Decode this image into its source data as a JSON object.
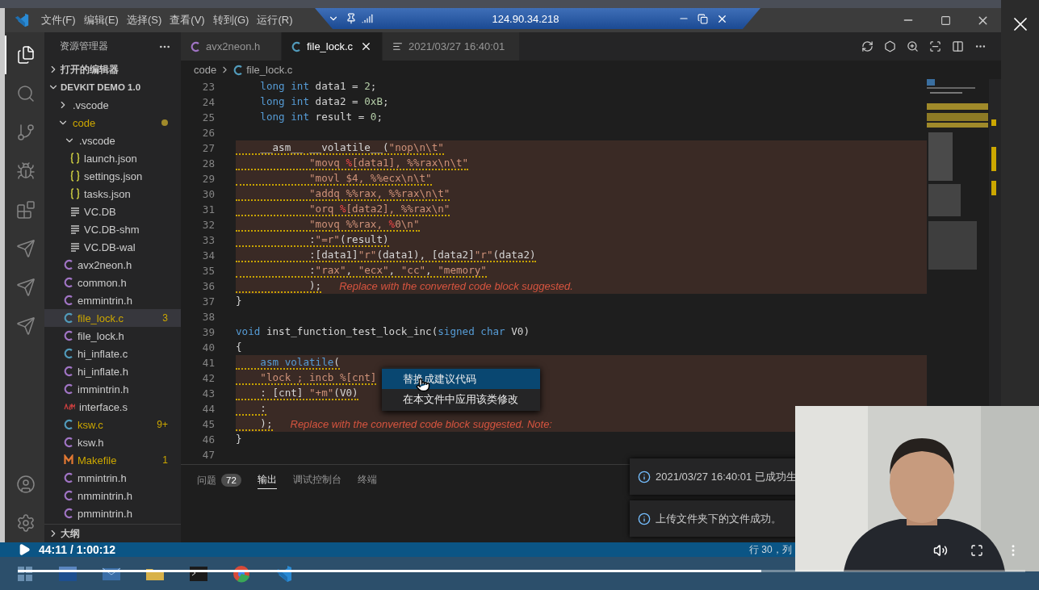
{
  "title_bar": {
    "menus": [
      "文件(F)",
      "编辑(E)",
      "选择(S)",
      "查看(V)",
      "转到(G)",
      "运行(R)"
    ]
  },
  "remote_bar": {
    "host": "124.90.34.218"
  },
  "activity_bar": [
    {
      "kind": "explorer",
      "selected": true
    },
    {
      "kind": "search",
      "selected": false
    },
    {
      "kind": "scm",
      "selected": false
    },
    {
      "kind": "debug",
      "selected": false
    },
    {
      "kind": "extensions",
      "selected": false
    },
    {
      "kind": "plugin",
      "selected": false
    },
    {
      "kind": "plugin",
      "selected": false
    },
    {
      "kind": "plugin",
      "selected": false
    },
    {
      "kind": "account",
      "selected": false
    },
    {
      "kind": "settings",
      "selected": false
    }
  ],
  "sidebar": {
    "title": "资源管理器",
    "open_editors": {
      "label": "打开的编辑器",
      "expanded": false
    },
    "workspace": {
      "label": "DEVKIT DEMO 1.0",
      "expanded": true,
      "items": [
        {
          "name": ".vscode",
          "kind": "folder",
          "expanded": false,
          "warning": false,
          "selected": false
        },
        {
          "name": "code",
          "kind": "folder",
          "expanded": true,
          "warning": true,
          "selected": false,
          "children": [
            {
              "name": ".vscode",
              "kind": "folder",
              "expanded": true,
              "warning": false,
              "selected": false,
              "children": [
                {
                  "name": "launch.json",
                  "kind": "json",
                  "warning": false,
                  "selected": false
                },
                {
                  "name": "settings.json",
                  "kind": "json",
                  "warning": false,
                  "selected": false
                },
                {
                  "name": "tasks.json",
                  "kind": "json",
                  "warning": false,
                  "selected": false
                },
                {
                  "name": "VC.DB",
                  "kind": "text",
                  "warning": false,
                  "selected": false
                },
                {
                  "name": "VC.DB-shm",
                  "kind": "text",
                  "warning": false,
                  "selected": false
                },
                {
                  "name": "VC.DB-wal",
                  "kind": "text",
                  "warning": false,
                  "selected": false
                }
              ]
            },
            {
              "name": "avx2neon.h",
              "kind": "header",
              "warning": false,
              "selected": false
            },
            {
              "name": "common.h",
              "kind": "header",
              "warning": false,
              "selected": false
            },
            {
              "name": "emmintrin.h",
              "kind": "header",
              "warning": false,
              "selected": false
            },
            {
              "name": "file_lock.c",
              "kind": "c",
              "warning": true,
              "selected": true,
              "badge": "3"
            },
            {
              "name": "file_lock.h",
              "kind": "header",
              "warning": false,
              "selected": false
            },
            {
              "name": "hi_inflate.c",
              "kind": "c",
              "warning": false,
              "selected": false
            },
            {
              "name": "hi_inflate.h",
              "kind": "header",
              "warning": false,
              "selected": false
            },
            {
              "name": "immintrin.h",
              "kind": "header",
              "warning": false,
              "selected": false
            },
            {
              "name": "interface.s",
              "kind": "asm",
              "warning": false,
              "selected": false
            },
            {
              "name": "ksw.c",
              "kind": "c",
              "warning": true,
              "selected": false,
              "badge": "9+"
            },
            {
              "name": "ksw.h",
              "kind": "header",
              "warning": false,
              "selected": false
            },
            {
              "name": "Makefile",
              "kind": "make",
              "warning": true,
              "selected": false,
              "badge": "1"
            },
            {
              "name": "mmintrin.h",
              "kind": "header",
              "warning": false,
              "selected": false
            },
            {
              "name": "nmmintrin.h",
              "kind": "header",
              "warning": false,
              "selected": false
            },
            {
              "name": "pmmintrin.h",
              "kind": "header",
              "warning": false,
              "selected": false
            }
          ]
        }
      ]
    },
    "outline": {
      "label": "大纲",
      "expanded": false
    }
  },
  "tabs": [
    {
      "label": "avx2neon.h",
      "kind": "header",
      "selected": false
    },
    {
      "label": "file_lock.c",
      "kind": "c",
      "selected": true
    },
    {
      "label": "2021/03/27 16:40:01",
      "kind": "output",
      "selected": false
    }
  ],
  "breadcrumb": [
    {
      "label": "code",
      "kind": "folder"
    },
    {
      "label": "file_lock.c",
      "kind": "c"
    }
  ],
  "code": {
    "lines": [
      {
        "num": "23",
        "highlight": false,
        "squiggle": false,
        "tokens": [
          {
            "kind": "kw",
            "text": "    long int"
          },
          {
            "kind": "plain",
            "text": " data1 = "
          },
          {
            "kind": "num",
            "text": "2"
          },
          {
            "kind": "plain",
            "text": ";"
          }
        ]
      },
      {
        "num": "24",
        "highlight": false,
        "squiggle": false,
        "tokens": [
          {
            "kind": "kw",
            "text": "    long int"
          },
          {
            "kind": "plain",
            "text": " data2 = "
          },
          {
            "kind": "num",
            "text": "0xB"
          },
          {
            "kind": "plain",
            "text": ";"
          }
        ]
      },
      {
        "num": "25",
        "highlight": false,
        "squiggle": false,
        "tokens": [
          {
            "kind": "kw",
            "text": "    long int"
          },
          {
            "kind": "plain",
            "text": " result = "
          },
          {
            "kind": "num",
            "text": "0"
          },
          {
            "kind": "plain",
            "text": ";"
          }
        ]
      },
      {
        "num": "26",
        "highlight": false
      },
      {
        "num": "27",
        "highlight": true,
        "squiggle": true,
        "tokens": [
          {
            "kind": "plain",
            "text": "    __asm__ __volatile__("
          },
          {
            "kind": "str",
            "text": "\"nop\\n\\t\""
          }
        ]
      },
      {
        "num": "28",
        "highlight": true,
        "squiggle": true,
        "tokens": [
          {
            "kind": "str",
            "text": "            \"movq "
          },
          {
            "kind": "fmt",
            "text": "%"
          },
          {
            "kind": "str",
            "text": "[data1], %%rax\\n\\t\""
          }
        ]
      },
      {
        "num": "29",
        "highlight": true,
        "squiggle": true,
        "tokens": [
          {
            "kind": "str",
            "text": "            \"movl $4, %%ecx\\n\\t\""
          }
        ]
      },
      {
        "num": "30",
        "highlight": true,
        "squiggle": true,
        "tokens": [
          {
            "kind": "str",
            "text": "            \"addq %%rax, %%rax\\n\\t\""
          }
        ]
      },
      {
        "num": "31",
        "highlight": true,
        "squiggle": true,
        "tokens": [
          {
            "kind": "str",
            "text": "            \"orq "
          },
          {
            "kind": "fmt",
            "text": "%"
          },
          {
            "kind": "str",
            "text": "[data2], %%rax\\n\""
          }
        ]
      },
      {
        "num": "32",
        "highlight": true,
        "squiggle": true,
        "tokens": [
          {
            "kind": "str",
            "text": "            \"movq %%rax, "
          },
          {
            "kind": "fmt",
            "text": "%"
          },
          {
            "kind": "str",
            "text": "0\\n\""
          }
        ]
      },
      {
        "num": "33",
        "highlight": true,
        "squiggle": true,
        "tokens": [
          {
            "kind": "plain",
            "text": "            :"
          },
          {
            "kind": "str",
            "text": "\"=r\""
          },
          {
            "kind": "plain",
            "text": "(result)"
          }
        ]
      },
      {
        "num": "34",
        "highlight": true,
        "squiggle": true,
        "tokens": [
          {
            "kind": "plain",
            "text": "            :[data1]"
          },
          {
            "kind": "str",
            "text": "\"r\""
          },
          {
            "kind": "plain",
            "text": "(data1), [data2]"
          },
          {
            "kind": "str",
            "text": "\"r\""
          },
          {
            "kind": "plain",
            "text": "(data2)"
          }
        ]
      },
      {
        "num": "35",
        "highlight": true,
        "squiggle": true,
        "tokens": [
          {
            "kind": "plain",
            "text": "            :"
          },
          {
            "kind": "str",
            "text": "\"rax\""
          },
          {
            "kind": "plain",
            "text": ", "
          },
          {
            "kind": "str",
            "text": "\"ecx\""
          },
          {
            "kind": "plain",
            "text": ", "
          },
          {
            "kind": "str",
            "text": "\"cc\""
          },
          {
            "kind": "plain",
            "text": ", "
          },
          {
            "kind": "str",
            "text": "\"memory\""
          }
        ]
      },
      {
        "num": "36",
        "highlight": true,
        "squiggle": true,
        "tokens": [
          {
            "kind": "plain",
            "text": "            );"
          }
        ],
        "hint": "Replace with the converted code block suggested."
      },
      {
        "num": "37",
        "highlight": false,
        "squiggle": false,
        "tokens": [
          {
            "kind": "plain",
            "text": "}"
          }
        ]
      },
      {
        "num": "38",
        "highlight": false
      },
      {
        "num": "39",
        "highlight": false,
        "squiggle": false,
        "tokens": [
          {
            "kind": "kw",
            "text": "void"
          },
          {
            "kind": "plain",
            "text": " inst_function_test_lock_inc("
          },
          {
            "kind": "kw",
            "text": "signed char"
          },
          {
            "kind": "plain",
            "text": " V0)"
          }
        ]
      },
      {
        "num": "40",
        "highlight": false,
        "squiggle": false,
        "tokens": [
          {
            "kind": "plain",
            "text": "{"
          }
        ]
      },
      {
        "num": "41",
        "highlight": true,
        "squiggle": true,
        "tokens": [
          {
            "kind": "kw",
            "text": "    asm volatile"
          },
          {
            "kind": "plain",
            "text": "("
          }
        ]
      },
      {
        "num": "42",
        "highlight": true,
        "squiggle": true,
        "tokens": [
          {
            "kind": "str",
            "text": "    \"lock ; incb %[cnt]"
          }
        ]
      },
      {
        "num": "43",
        "highlight": true,
        "squiggle": true,
        "tokens": [
          {
            "kind": "plain",
            "text": "    : [cnt] "
          },
          {
            "kind": "str",
            "text": "\"+m\""
          },
          {
            "kind": "plain",
            "text": "(V0)"
          }
        ]
      },
      {
        "num": "44",
        "highlight": true,
        "squiggle": true,
        "tokens": [
          {
            "kind": "plain",
            "text": "    :"
          }
        ]
      },
      {
        "num": "45",
        "highlight": true,
        "squiggle": true,
        "tokens": [
          {
            "kind": "plain",
            "text": "    );"
          }
        ],
        "hint": "Replace with the converted code block suggested. Note:"
      },
      {
        "num": "46",
        "highlight": false,
        "squiggle": false,
        "tokens": [
          {
            "kind": "plain",
            "text": "}"
          }
        ]
      },
      {
        "num": "47",
        "highlight": false
      }
    ]
  },
  "context_menu": [
    {
      "label": "替换成建议代码",
      "selected": true
    },
    {
      "label": "在本文件中应用该类修改",
      "selected": false
    }
  ],
  "panel_tabs": [
    {
      "label": "问题",
      "badge": "72",
      "selected": false
    },
    {
      "label": "输出",
      "selected": true
    },
    {
      "label": "调试控制台",
      "selected": false
    },
    {
      "label": "终端",
      "selected": false
    }
  ],
  "notifications": [
    {
      "text": "2021/03/27 16:40:01 已成功生"
    },
    {
      "text": "上传文件夹下的文件成功。"
    }
  ],
  "status_bar": {
    "position": "行 30，列"
  },
  "video": {
    "time": "44:11 / 1:00:12",
    "level": 0.738
  },
  "taskbar": [
    {
      "kind": "start"
    },
    {
      "kind": "window"
    },
    {
      "kind": "mail"
    },
    {
      "kind": "folder"
    },
    {
      "kind": "terminal"
    },
    {
      "kind": "browser"
    },
    {
      "kind": "editor"
    }
  ]
}
